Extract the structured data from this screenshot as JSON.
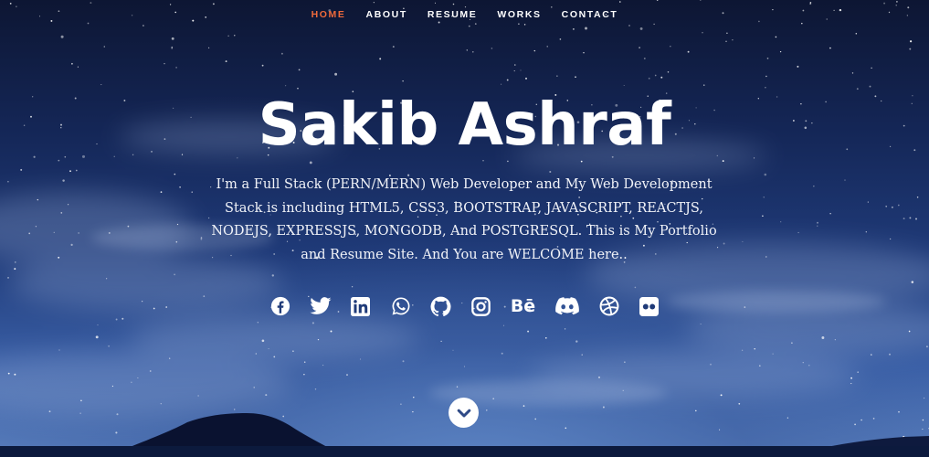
{
  "nav": {
    "items": [
      {
        "label": "HOME",
        "active": true
      },
      {
        "label": "ABOUT",
        "active": false
      },
      {
        "label": "RESUME",
        "active": false
      },
      {
        "label": "WORKS",
        "active": false
      },
      {
        "label": "CONTACT",
        "active": false
      }
    ],
    "active_color": "#f06a3b"
  },
  "hero": {
    "title": "Sakib Ashraf",
    "intro": "I'm a Full Stack (PERN/MERN) Web Developer and My Web Development Stack is including HTML5, CSS3, BOOTSTRAP, JAVASCRIPT, REACTJS, NODEJS, EXPRESSJS, MONGODB, And POSTGRESQL. This is My Portfolio and Resume Site. And You are WELCOME here.."
  },
  "social": {
    "icons": [
      "facebook-icon",
      "twitter-icon",
      "linkedin-icon",
      "whatsapp-icon",
      "github-icon",
      "instagram-icon",
      "behance-icon",
      "discord-icon",
      "dribbble-icon",
      "flickr-icon"
    ],
    "behance_text": "Bē"
  },
  "scroll": {
    "icon": "chevron-down-icon"
  }
}
